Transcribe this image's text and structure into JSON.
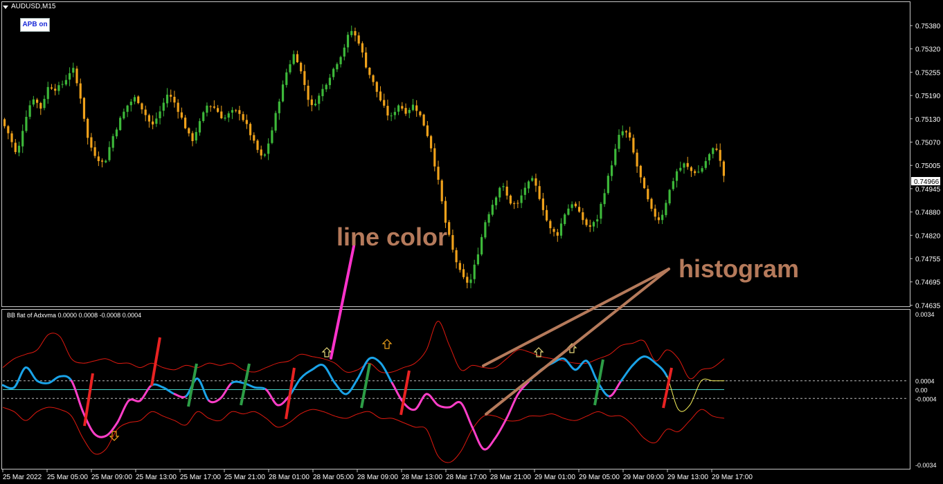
{
  "window": {
    "symbol_title": "AUDUSD,M15",
    "button_label": "APB on",
    "current_price_label": "0.74966"
  },
  "indicator": {
    "title": "BB flat of Adxvma  0.0000 0.0008 -0.0008 0.0004",
    "levels": [
      "0.0004",
      "0.00",
      "-0.0004"
    ],
    "top_label": "0.0034",
    "bottom_label": "-0.0034"
  },
  "annotations": {
    "line_color": "line color",
    "histogram": "histogram"
  },
  "colors": {
    "up_candle": "#3db83a",
    "down_candle": "#f0a21b",
    "bands": "#e0190f",
    "line_up": "#1aa3e8",
    "line_down": "#ff3ec8",
    "line_flat": "#f7f05a",
    "hist_up": "#2d9d46",
    "hist_down": "#e82222",
    "annotation": "#b57a5b",
    "arrow_pink": "#ff33cc"
  },
  "chart_data": [
    {
      "type": "candlestick",
      "symbol": "AUDUSD",
      "timeframe": "M15",
      "y_ticks": [
        "0.75380",
        "0.75320",
        "0.75255",
        "0.75190",
        "0.75130",
        "0.75070",
        "0.75005",
        "0.74945",
        "0.74880",
        "0.74820",
        "0.74755",
        "0.74695",
        "0.74635"
      ],
      "x_ticks": [
        "25 Mar 2022",
        "25 Mar 05:00",
        "25 Mar 09:00",
        "25 Mar 13:00",
        "25 Mar 17:00",
        "25 Mar 21:00",
        "28 Mar 01:00",
        "28 Mar 05:00",
        "28 Mar 09:00",
        "28 Mar 13:00",
        "28 Mar 17:00",
        "28 Mar 21:00",
        "29 Mar 01:00",
        "29 Mar 05:00",
        "29 Mar 09:00",
        "29 Mar 13:00",
        "29 Mar 17:00"
      ],
      "ylim": [
        0.74635,
        0.7538
      ],
      "last_price": 0.74966,
      "close_path": [
        0.7513,
        0.7509,
        0.7503,
        0.7513,
        0.7519,
        0.7516,
        0.7522,
        0.7521,
        0.7523,
        0.7527,
        0.7519,
        0.7507,
        0.7503,
        0.7501,
        0.7508,
        0.7513,
        0.7517,
        0.7519,
        0.7515,
        0.7511,
        0.7515,
        0.752,
        0.7517,
        0.7512,
        0.7507,
        0.7512,
        0.7517,
        0.7516,
        0.7513,
        0.7515,
        0.7515,
        0.7511,
        0.7506,
        0.7502,
        0.7509,
        0.7518,
        0.7526,
        0.7531,
        0.7524,
        0.7516,
        0.7519,
        0.7523,
        0.7527,
        0.7531,
        0.7537,
        0.7534,
        0.7527,
        0.7522,
        0.7517,
        0.7513,
        0.7517,
        0.7515,
        0.7517,
        0.7513,
        0.7507,
        0.7497,
        0.7485,
        0.7477,
        0.7471,
        0.7469,
        0.7477,
        0.7486,
        0.7491,
        0.7496,
        0.7491,
        0.749,
        0.7495,
        0.7497,
        0.7491,
        0.7484,
        0.7482,
        0.7488,
        0.7491,
        0.7487,
        0.7484,
        0.7486,
        0.7494,
        0.7502,
        0.751,
        0.7509,
        0.7501,
        0.7494,
        0.7488,
        0.7486,
        0.7493,
        0.7499,
        0.7501,
        0.7499,
        0.7499,
        0.7503,
        0.7506,
        0.7498
      ]
    },
    {
      "type": "line",
      "name": "BB flat of Adxvma",
      "ylim": [
        -0.0034,
        0.0034
      ],
      "levels": [
        0.0004,
        0.0,
        -0.0004
      ],
      "series": [
        {
          "name": "line",
          "values": [
            0.0002,
            0.0001,
            0.001,
            0.0004,
            0.0003,
            0.0006,
            0.0004,
            -0.001,
            -0.002,
            -0.0021,
            -0.0015,
            -0.0005,
            -0.0005,
            0.0002,
            0.0001,
            -0.0002,
            -0.0003,
            0.0005,
            -0.0005,
            -0.0004,
            0.0003,
            0.0003,
            0.0001,
            0.0,
            -0.0007,
            -0.0003,
            0.0005,
            0.0009,
            0.0011,
            0.0003,
            -0.0002,
            0.0005,
            0.0014,
            0.0012,
            0.0003,
            -0.0006,
            -0.0009,
            -0.0002,
            -0.0007,
            -0.0008,
            -0.0006,
            -0.0017,
            -0.0027,
            -0.0022,
            -0.0013,
            -0.0002,
            0.0004,
            0.0009,
            0.0012,
            0.0014,
            0.0009,
            0.0013,
            0.0003,
            -0.0003,
            0.0004,
            0.0011,
            0.0015,
            0.0012,
            0.0006,
            -0.0009,
            -0.0007,
            0.0004,
            0.0004,
            0.0004
          ]
        },
        {
          "name": "upper band",
          "values": [
            0.001,
            0.0014,
            0.0016,
            0.0018,
            0.0025,
            0.0024,
            0.0014,
            0.0012,
            0.0013,
            0.0014,
            0.0012,
            0.0012,
            0.001,
            0.0012,
            0.001,
            0.0009,
            0.0011,
            0.001,
            0.0012,
            0.0011,
            0.0012,
            0.0009,
            0.0008,
            0.001,
            0.0012,
            0.0013,
            0.0016,
            0.0015,
            0.0014,
            0.0012,
            0.0008,
            0.0009,
            0.0012,
            0.0008,
            0.0008,
            0.001,
            0.0012,
            0.0018,
            0.0031,
            0.002,
            0.0009,
            0.0011,
            0.001,
            0.001,
            0.0014,
            0.0018,
            0.0017,
            0.0015,
            0.0014,
            0.0013,
            0.0012,
            0.0012,
            0.0014,
            0.0016,
            0.002,
            0.0021,
            0.0022,
            0.0013,
            0.0018,
            0.0014,
            0.0005,
            0.0009,
            0.001,
            0.0014
          ]
        },
        {
          "name": "lower band",
          "values": [
            -0.0008,
            -0.001,
            -0.0014,
            -0.001,
            -0.0008,
            -0.0009,
            -0.0012,
            -0.0022,
            -0.0029,
            -0.0027,
            -0.0018,
            -0.0015,
            -0.0014,
            -0.001,
            -0.0012,
            -0.0014,
            -0.0016,
            -0.001,
            -0.0013,
            -0.0014,
            -0.001,
            -0.0011,
            -0.001,
            -0.0013,
            -0.0017,
            -0.0015,
            -0.0011,
            -0.0009,
            -0.001,
            -0.0012,
            -0.0013,
            -0.0011,
            -0.001,
            -0.0013,
            -0.0013,
            -0.0015,
            -0.0017,
            -0.0018,
            -0.003,
            -0.0033,
            -0.0028,
            -0.0018,
            -0.0012,
            -0.0012,
            -0.0014,
            -0.0014,
            -0.0012,
            -0.0012,
            -0.0011,
            -0.0013,
            -0.0014,
            -0.0012,
            -0.001,
            -0.0012,
            -0.0012,
            -0.0016,
            -0.0022,
            -0.0024,
            -0.0018,
            -0.0019,
            -0.0014,
            -0.0009,
            -0.0012,
            -0.0013
          ]
        }
      ]
    }
  ]
}
